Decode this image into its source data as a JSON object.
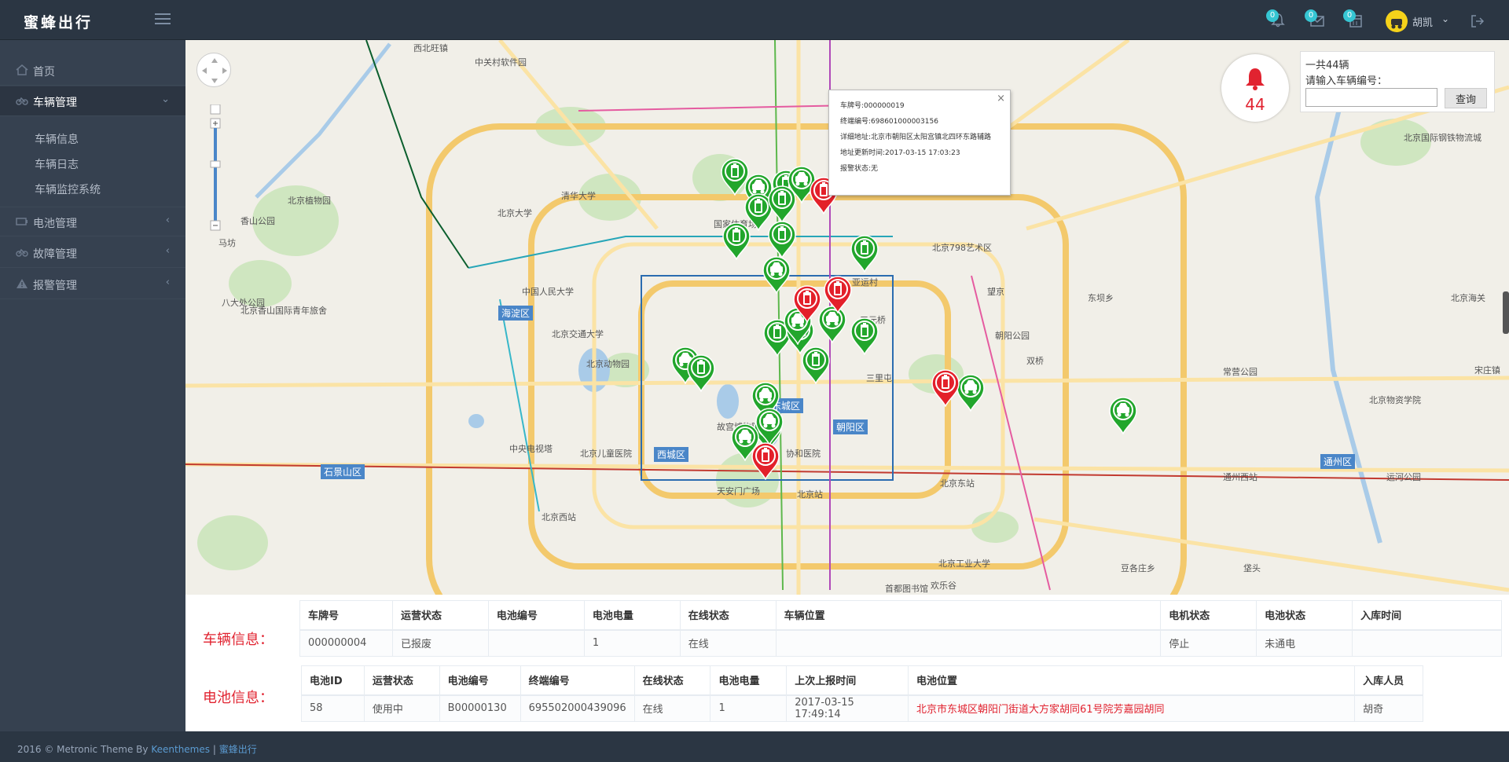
{
  "app": {
    "logo": "蜜蜂出行"
  },
  "header": {
    "notifications": [
      {
        "icon": "bell-icon",
        "count": "0"
      },
      {
        "icon": "envelope-icon",
        "count": "0"
      },
      {
        "icon": "calendar-icon",
        "count": "0"
      }
    ],
    "user": {
      "name": "胡凯",
      "avatar": "user-avatar"
    },
    "logout_icon": "logout-icon"
  },
  "sidebar": {
    "items": [
      {
        "label": "首页",
        "icon": "home-icon"
      },
      {
        "label": "车辆管理",
        "icon": "vehicle-icon"
      },
      {
        "label": "电池管理",
        "icon": "battery-icon"
      },
      {
        "label": "故障管理",
        "icon": "vehicle-icon"
      },
      {
        "label": "报警管理",
        "icon": "warning-icon"
      }
    ],
    "subitems": [
      "车辆信息",
      "车辆日志",
      "车辆监控系统"
    ]
  },
  "map": {
    "info_window": {
      "plate": "车牌号:000000019",
      "terminal": "终端编号:698601000003156",
      "address": "详细地址:北京市朝阳区太阳宫镇北四环东路辅路",
      "updated": "地址更新时间:2017-03-15 17:03:23",
      "alarm": "报警状态:无"
    },
    "alarm_count": "44",
    "search": {
      "total": "一共44辆",
      "label": "请输入车辆编号：",
      "value": "",
      "button": "查询"
    },
    "districts": [
      "海淀区",
      "东城区",
      "西城区",
      "朝阳区",
      "石景山区",
      "通州区"
    ],
    "places": [
      "西北旺镇",
      "中关村软件园",
      "北京大学",
      "清华大学",
      "国家体育场",
      "北京798艺术区",
      "朝阳公园",
      "北京动物园",
      "故宫博物院",
      "天安门广场",
      "北京西站",
      "北京站",
      "北京东站",
      "欢乐谷",
      "亚运村",
      "三元桥",
      "三里屯",
      "望京",
      "东坝乡",
      "常营公园",
      "通州西站",
      "北京植物园",
      "北京香山国际青年旅舍",
      "香山公园",
      "八大处公园",
      "中国人民大学",
      "北京交通大学",
      "中央电视塔",
      "北京儿童医院",
      "协和医院",
      "双桥",
      "北京工业大学",
      "豆各庄乡",
      "垡头",
      "首都图书馆",
      "宋庄镇",
      "北京物资学院",
      "北京国际钢铁物流城",
      "运河公园",
      "北京海关",
      "马坊"
    ],
    "markers_green": 30,
    "markers_red": 5,
    "colors": {
      "green": "#22a62c",
      "red": "#e3202a",
      "district": "#4a86c8"
    }
  },
  "vehicle_info": {
    "title": "车辆信息：",
    "headers": [
      "车牌号",
      "运营状态",
      "电池编号",
      "电池电量",
      "在线状态",
      "车辆位置",
      "电机状态",
      "电池状态",
      "入库时间"
    ],
    "row": [
      "000000004",
      "已报废",
      "",
      "1",
      "在线",
      "",
      "停止",
      "未通电",
      ""
    ]
  },
  "battery_info": {
    "title": "电池信息：",
    "headers": [
      "电池ID",
      "运营状态",
      "电池编号",
      "终端编号",
      "在线状态",
      "电池电量",
      "上次上报时间",
      "电池位置",
      "入库人员"
    ],
    "row": [
      "58",
      "使用中",
      "B00000130",
      "695502000439096",
      "在线",
      "1",
      "2017-03-15 17:49:14",
      "北京市东城区朝阳门街道大方家胡同61号院芳嘉园胡同",
      "胡奇"
    ]
  },
  "footer": {
    "copyright": "2016 © Metronic Theme By",
    "link1": "Keenthemes",
    "sep": "|",
    "link2": "蜜蜂出行"
  }
}
